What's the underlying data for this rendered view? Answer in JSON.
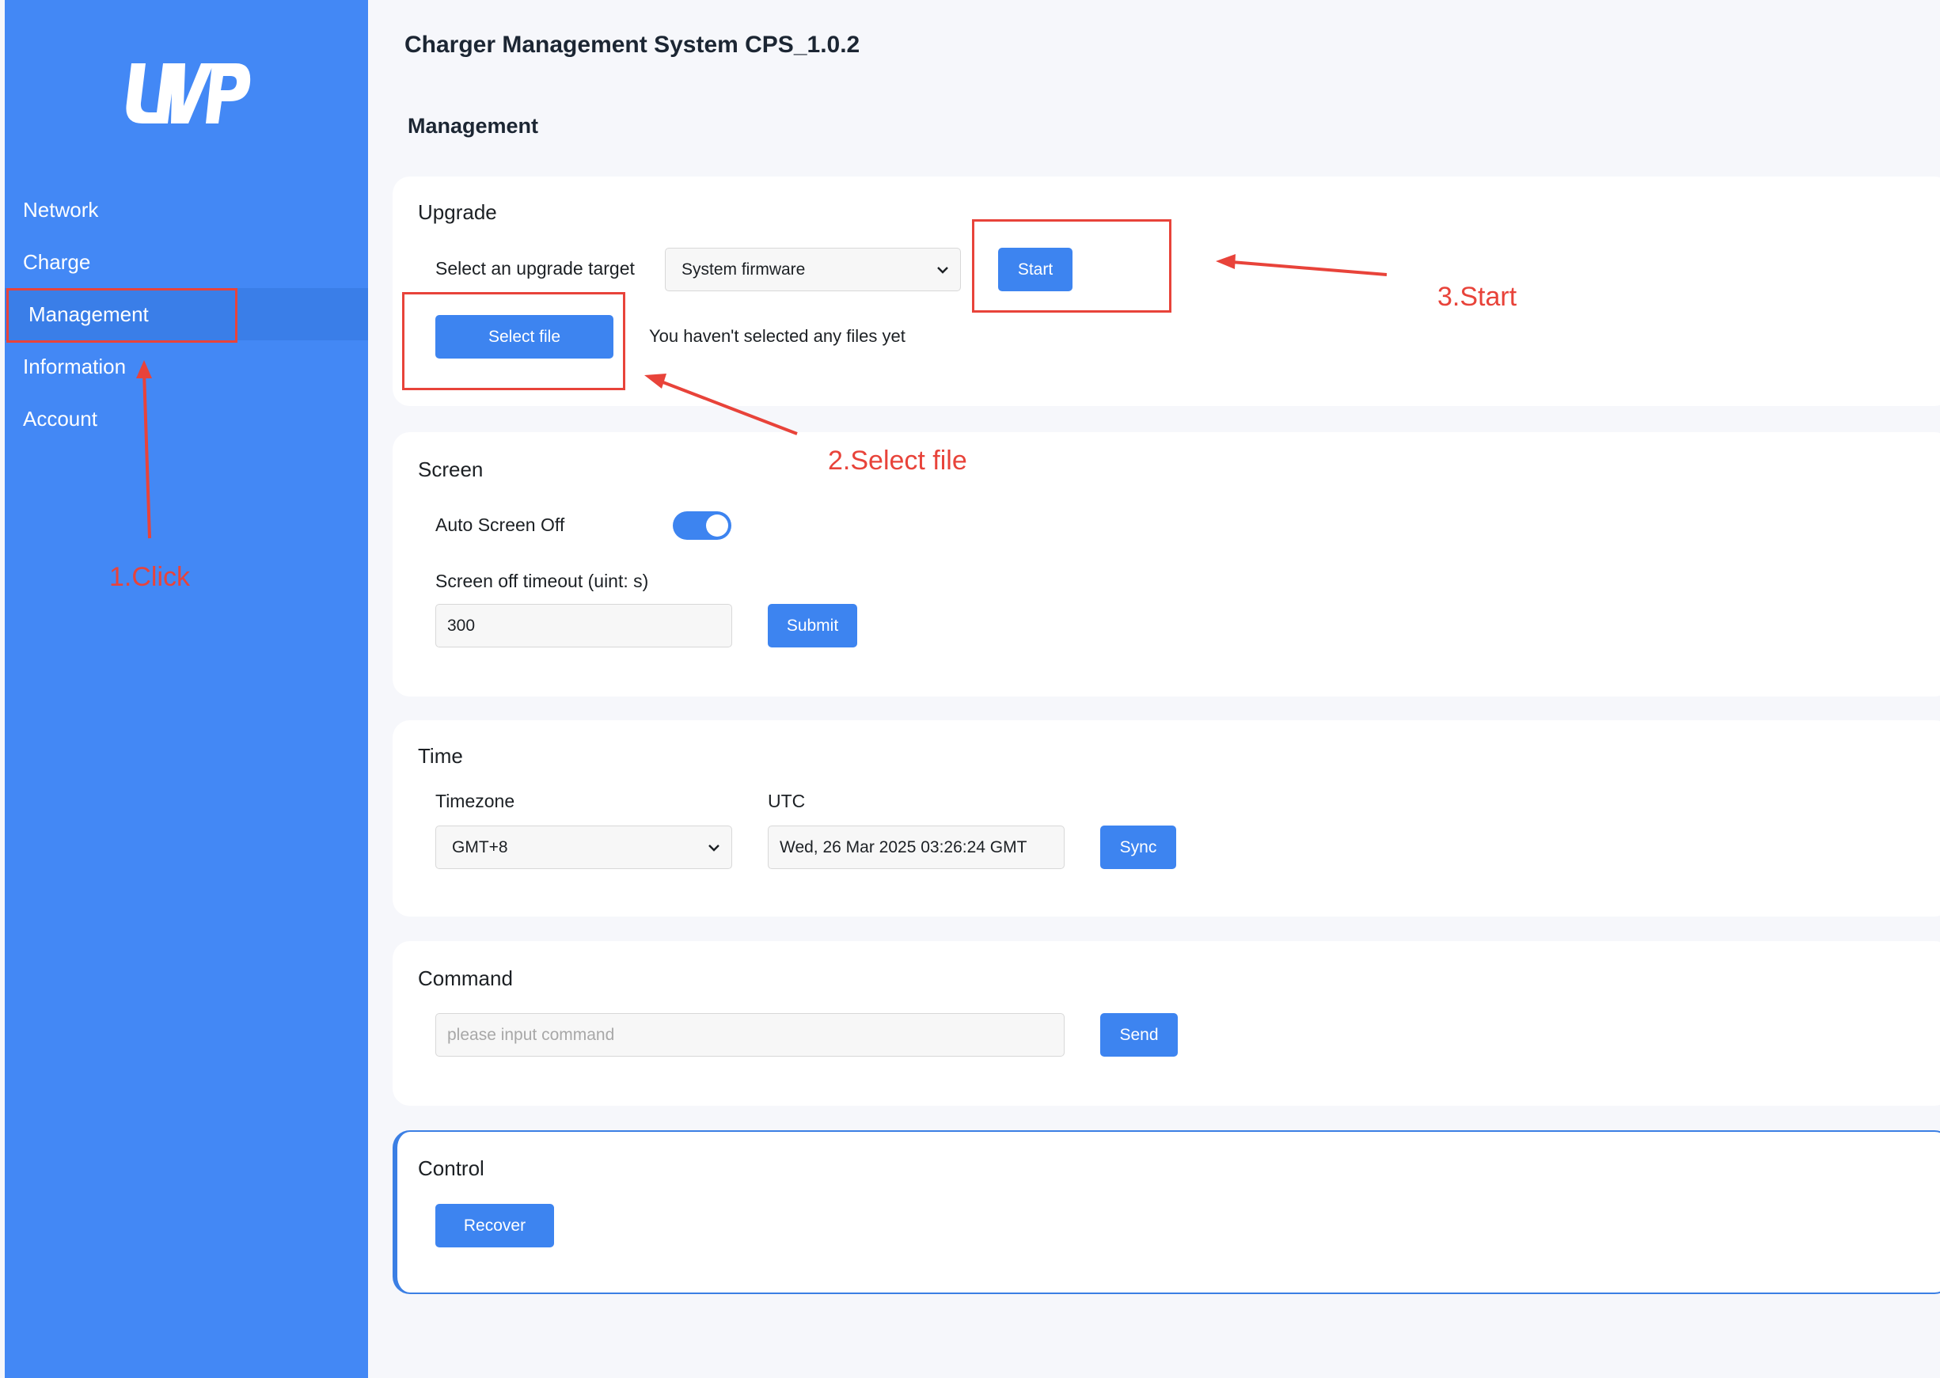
{
  "app": {
    "title": "Charger Management System CPS_1.0.2"
  },
  "page": {
    "title": "Management"
  },
  "sidebar": {
    "logo_icon": "uvp-logo",
    "items": [
      {
        "label": "Network",
        "active": false
      },
      {
        "label": "Charge",
        "active": false
      },
      {
        "label": "Management",
        "active": true
      },
      {
        "label": "Information",
        "active": false
      },
      {
        "label": "Account",
        "active": false
      }
    ]
  },
  "upgrade": {
    "title": "Upgrade",
    "target_label": "Select an upgrade target",
    "target_value": "System firmware",
    "start_label": "Start",
    "select_file_label": "Select file",
    "file_status": "You haven't selected any files yet"
  },
  "screen": {
    "title": "Screen",
    "auto_off_label": "Auto Screen Off",
    "auto_off_enabled": true,
    "timeout_label": "Screen off timeout (uint: s)",
    "timeout_value": "300",
    "submit_label": "Submit"
  },
  "time": {
    "title": "Time",
    "timezone_label": "Timezone",
    "timezone_value": "GMT+8",
    "utc_label": "UTC",
    "utc_value": "Wed, 26 Mar 2025 03:26:24 GMT",
    "sync_label": "Sync"
  },
  "command": {
    "title": "Command",
    "placeholder": "please input command",
    "send_label": "Send"
  },
  "control": {
    "title": "Control",
    "recover_label": "Recover"
  },
  "annotations": {
    "step1": "1.Click",
    "step2": "2.Select file",
    "step3": "3.Start",
    "color": "#e8433a"
  },
  "colors": {
    "sidebar": "#4388f5",
    "sidebar_active": "#3a7ee8",
    "button": "#3d84f0",
    "background": "#f6f7fb"
  }
}
